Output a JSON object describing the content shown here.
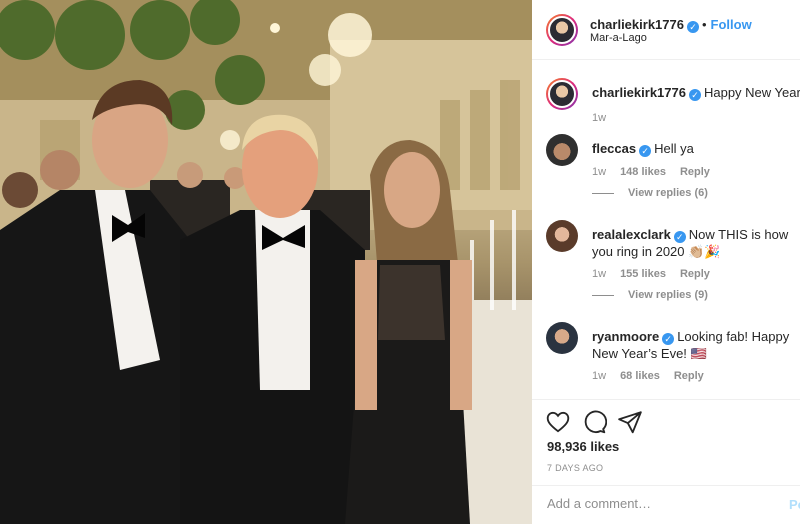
{
  "post": {
    "username": "charliekirk1776",
    "follow_label": "Follow",
    "location": "Mar-a-Lago"
  },
  "caption": {
    "username": "charliekirk1776",
    "text": "Happy New Year!",
    "age": "1w"
  },
  "comments": [
    {
      "username": "fleccas",
      "text": "Hell ya",
      "age": "1w",
      "likes": "148 likes",
      "reply": "Reply",
      "view_replies": "View replies (6)"
    },
    {
      "username": "realalexclark",
      "text": "Now THIS is how you ring in 2020 👏🏼🎉",
      "age": "1w",
      "likes": "155 likes",
      "reply": "Reply",
      "view_replies": "View replies (9)"
    },
    {
      "username": "ryanmoore",
      "text": "Looking fab! Happy New Year’s Eve! 🇺🇸",
      "age": "1w",
      "likes": "68 likes",
      "reply": "Reply"
    }
  ],
  "actions": {
    "icons": [
      "heart-icon",
      "comment-icon",
      "share-icon"
    ],
    "likes": "98,936 likes",
    "date": "7 DAYS AGO"
  },
  "composer": {
    "placeholder": "Add a comment…",
    "post_label": "Post"
  },
  "colors": {
    "accent": "#3897f0",
    "text": "#262626",
    "muted": "#8e8e8e",
    "border": "#efefef"
  }
}
